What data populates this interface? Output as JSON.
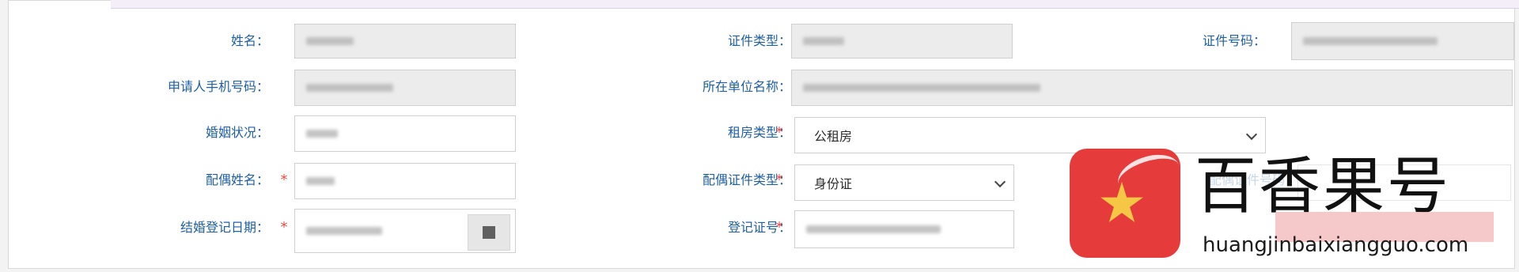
{
  "form": {
    "name": {
      "label": "姓名："
    },
    "id_type": {
      "label": "证件类型："
    },
    "id_number": {
      "label": "证件号码："
    },
    "applicant_phone": {
      "label": "申请人手机号码："
    },
    "employer_name": {
      "label": "所在单位名称："
    },
    "marital_status": {
      "label": "婚姻状况："
    },
    "rental_type": {
      "label": "租房类型：",
      "value": "公租房"
    },
    "spouse_name": {
      "label": "配偶姓名："
    },
    "spouse_id_type": {
      "label": "配偶证件类型：",
      "value": "身份证"
    },
    "spouse_id_number": {
      "label": "配偶证件号码："
    },
    "marriage_reg_date": {
      "label": "结婚登记日期："
    },
    "registration_number": {
      "label": "登记证号："
    },
    "required_mark": "*"
  },
  "watermark": {
    "title": "百香果号",
    "url": "huangjinbaixiangguo.com"
  },
  "colors": {
    "label_blue": "#1f5fa8",
    "required_red": "#e64a4a",
    "field_gray": "#ececec",
    "logo_red": "#e53b3b",
    "logo_star": "#f6c744"
  }
}
